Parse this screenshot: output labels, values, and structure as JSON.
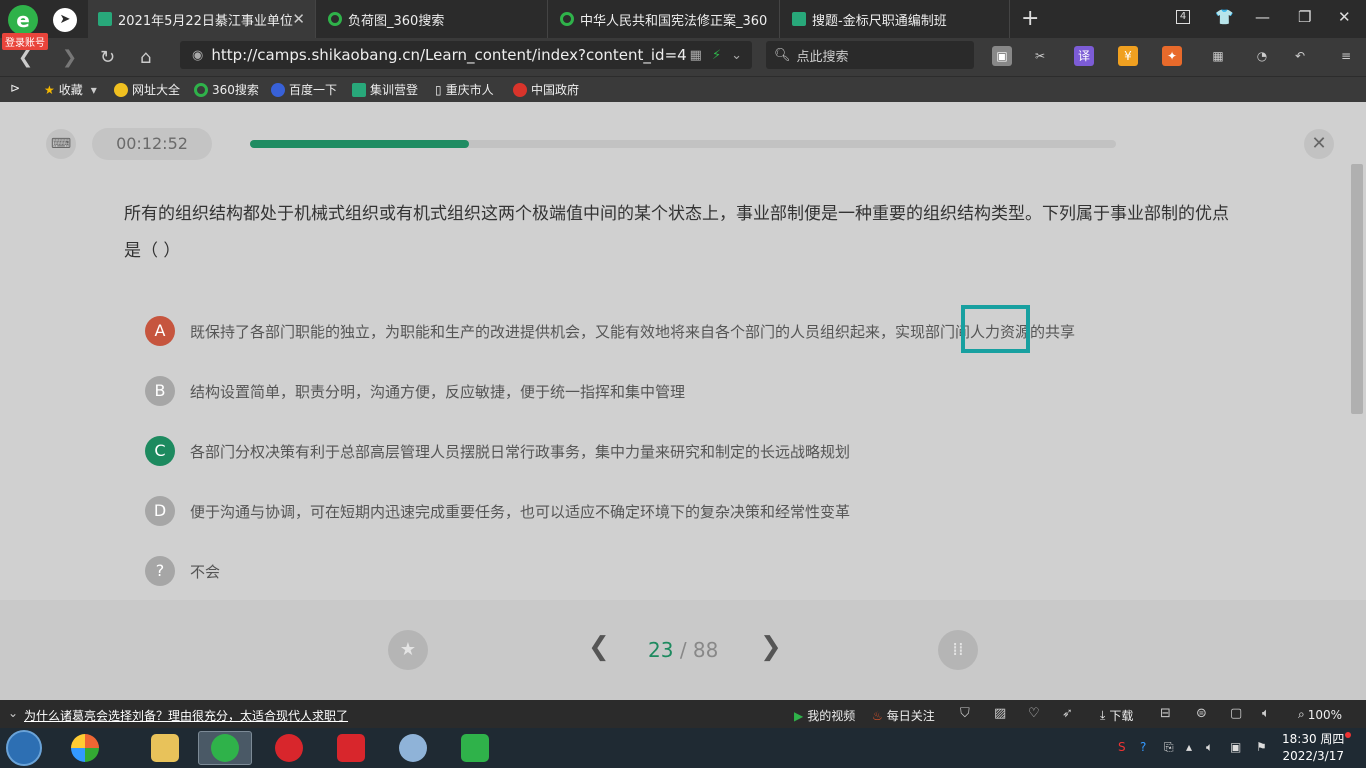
{
  "browser": {
    "login_badge": "登录账号",
    "tabs": [
      {
        "title": "2021年5月22日綦江事业单位"
      },
      {
        "title": "负荷图_360搜索"
      },
      {
        "title": "中华人民共和国宪法修正案_360"
      },
      {
        "title": "搜题-金标尺职通编制班"
      }
    ],
    "tab_count": "4",
    "url": "http://camps.shikaobang.cn/Learn_content/index?content_id=4",
    "search_placeholder": "点此搜索",
    "bookmarks": [
      "收藏",
      "网址大全",
      "360搜索",
      "百度一下",
      "集训营登",
      "重庆市人",
      "中国政府"
    ]
  },
  "quiz": {
    "timer": "00:12:52",
    "progress": 0.253,
    "question": "所有的组织结构都处于机械式组织或有机式组织这两个极端值中间的某个状态上，事业部制便是一种重要的组织结构类型。下列属于事业部制的优点是（    ）",
    "options": [
      {
        "letter": "A",
        "text": "既保持了各部门职能的独立，为职能和生产的改进提供机会，又能有效地将来自各个部门的人员组织起来，实现部门间人力资源的共享"
      },
      {
        "letter": "B",
        "text": "结构设置简单，职责分明，沟通方便，反应敏捷，便于统一指挥和集中管理"
      },
      {
        "letter": "C",
        "text": "各部门分权决策有利于总部高层管理人员摆脱日常行政事务，集中力量来研究和制定的长远战略规划"
      },
      {
        "letter": "D",
        "text": "便于沟通与协调，可在短期内迅速完成重要任务，也可以适应不确定环境下的复杂决策和经常性变革"
      },
      {
        "letter": "?",
        "text": "不会"
      }
    ],
    "pager": {
      "current": "23",
      "separator": "/",
      "total": "88"
    }
  },
  "statusbar": {
    "news": "为什么诸葛亮会选择刘备？理由很充分，太适合现代人求职了",
    "my_video": "我的视频",
    "daily_follow": "每日关注",
    "download": "下载",
    "zoom": "100%"
  },
  "taskbar": {
    "time": "18:30 周四",
    "date": "2022/3/17"
  },
  "colors": {
    "accent_green": "#1d8a5f",
    "option_a": "#c6553e",
    "highlight": "#18a0a0"
  }
}
